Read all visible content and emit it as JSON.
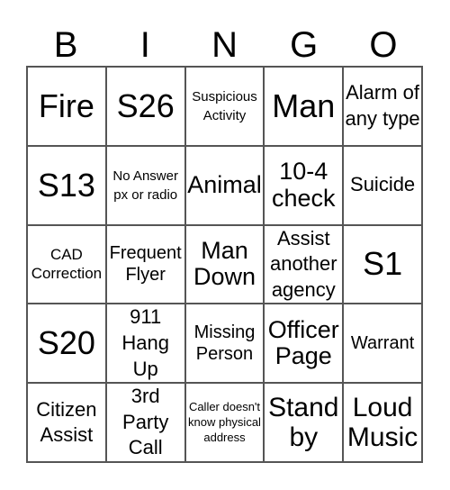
{
  "header": {
    "letters": [
      "B",
      "I",
      "N",
      "G",
      "O"
    ]
  },
  "cells": [
    "Fire",
    "S26",
    "Suspicious Activity",
    "Man",
    "Alarm of any type",
    "S13",
    "No Answer px or radio",
    "Animal",
    "10-4 check",
    "Suicide",
    "CAD Correction",
    "Frequent Flyer",
    "Man Down",
    "Assist another agency",
    "S1",
    "S20",
    "911 Hang Up",
    "Missing Person",
    "Officer Page",
    "Warrant",
    "Citizen Assist",
    "3rd Party Call",
    "Caller doesn't know physical address",
    "Stand by",
    "Loud Music"
  ]
}
